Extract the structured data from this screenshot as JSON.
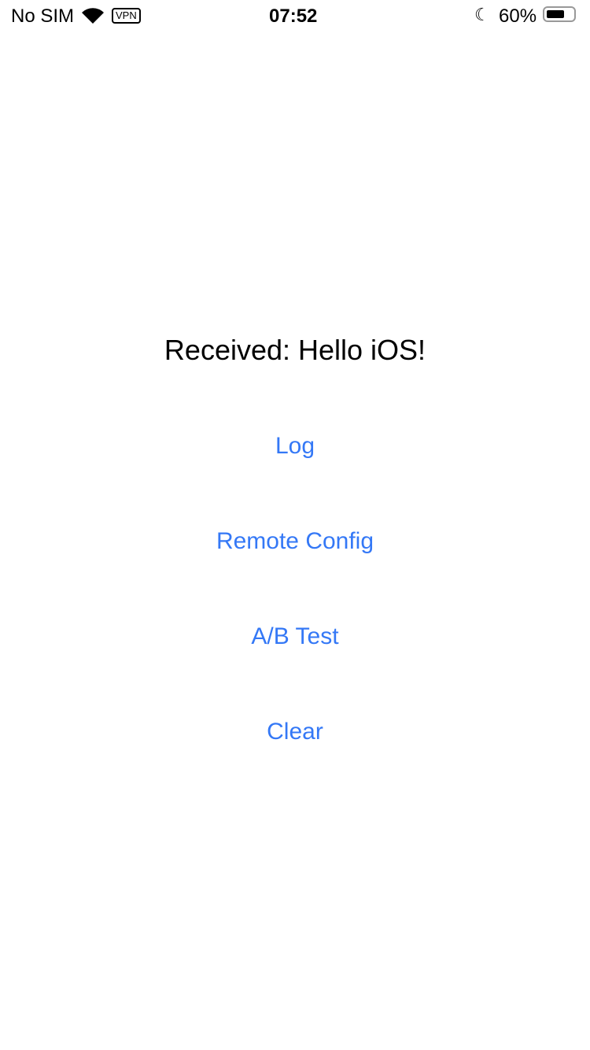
{
  "status": {
    "carrier": "No SIM",
    "vpn": "VPN",
    "time": "07:52",
    "battery": "60%",
    "battery_level": 0.6
  },
  "main": {
    "message": "Received: Hello iOS!",
    "buttons": [
      {
        "label": "Log"
      },
      {
        "label": "Remote Config"
      },
      {
        "label": "A/B Test"
      },
      {
        "label": "Clear"
      }
    ]
  },
  "colors": {
    "accent": "#3478f6"
  }
}
